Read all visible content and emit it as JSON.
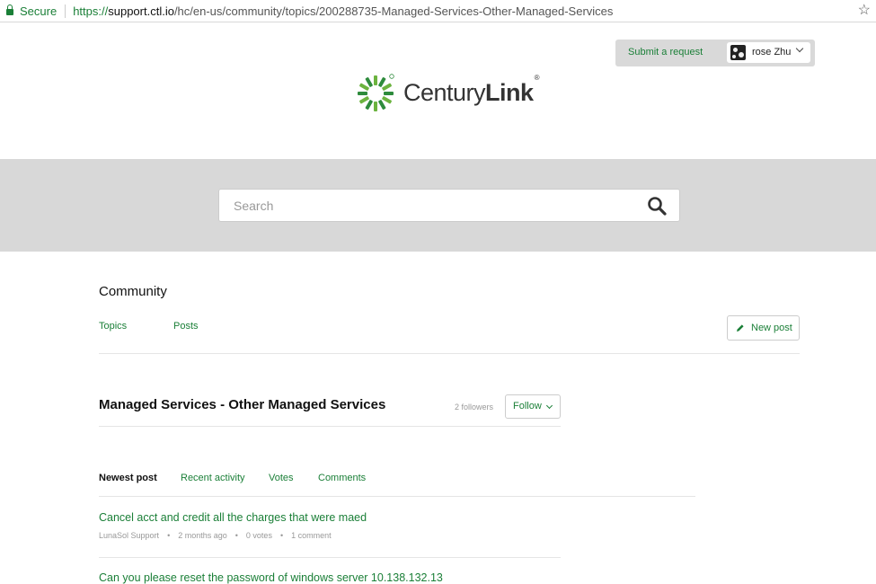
{
  "browser": {
    "secure_label": "Secure",
    "url_scheme": "https://",
    "url_host": "support.ctl.io",
    "url_path": "/hc/en-us/community/topics/200288735-Managed-Services-Other-Managed-Services"
  },
  "header": {
    "submit_request": "Submit a request",
    "user_name": "rose Zhu",
    "logo_text_light": "Century",
    "logo_text_bold": "Link",
    "logo_reg": "®"
  },
  "search": {
    "placeholder": "Search"
  },
  "community": {
    "title": "Community",
    "nav": {
      "topics": "Topics",
      "posts": "Posts"
    },
    "new_post": "New post"
  },
  "topic": {
    "title": "Managed Services - Other Managed Services",
    "followers": "2 followers",
    "follow": "Follow"
  },
  "sort_tabs": [
    "Newest post",
    "Recent activity",
    "Votes",
    "Comments"
  ],
  "posts": [
    {
      "title": "Cancel acct and credit all the charges that were maed",
      "author": "LunaSol Support",
      "time": "2 months ago",
      "votes": "0 votes",
      "comments": "1 comment"
    },
    {
      "title": "Can you please reset the password of windows server 10.138.132.13"
    }
  ],
  "colors": {
    "accent": "#1a7f37",
    "logo_green": "#6cb33f",
    "logo_dark_green": "#2e8b3c",
    "band": "#d8d8d8"
  }
}
